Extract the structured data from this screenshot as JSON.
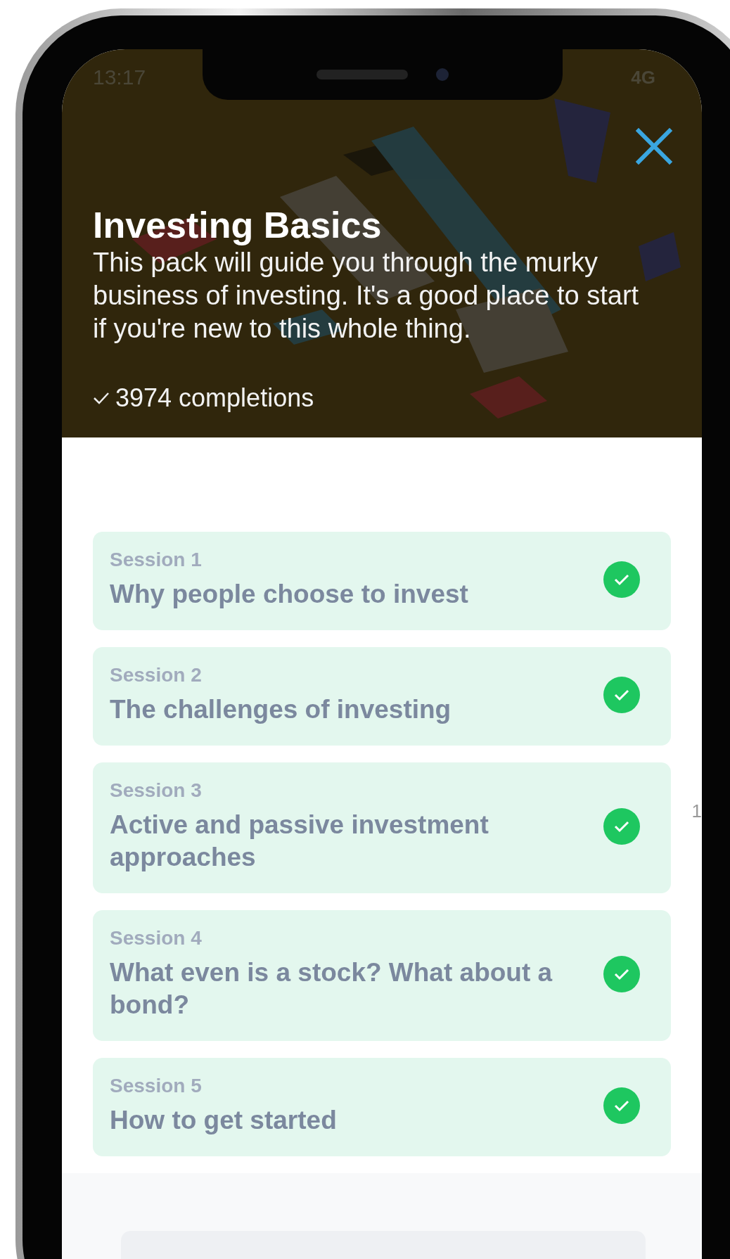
{
  "status_bar": {
    "time": "13:17",
    "network": "4G"
  },
  "pack": {
    "title": "Investing Basics",
    "description": "This pack will guide you through the murky business of investing. It's a good place to start if you're new to this whole thing.",
    "completions": "3974 completions"
  },
  "sessions": [
    {
      "label": "Session 1",
      "title": "Why people choose to invest",
      "completed": true
    },
    {
      "label": "Session 2",
      "title": "The challenges of investing",
      "completed": true
    },
    {
      "label": "Session 3",
      "title": "Active and passive investment approaches",
      "completed": true
    },
    {
      "label": "Session 4",
      "title": "What even is a stock? What about a bond?",
      "completed": true
    },
    {
      "label": "Session 5",
      "title": "How to get started",
      "completed": true
    }
  ],
  "edge_mark": "1"
}
